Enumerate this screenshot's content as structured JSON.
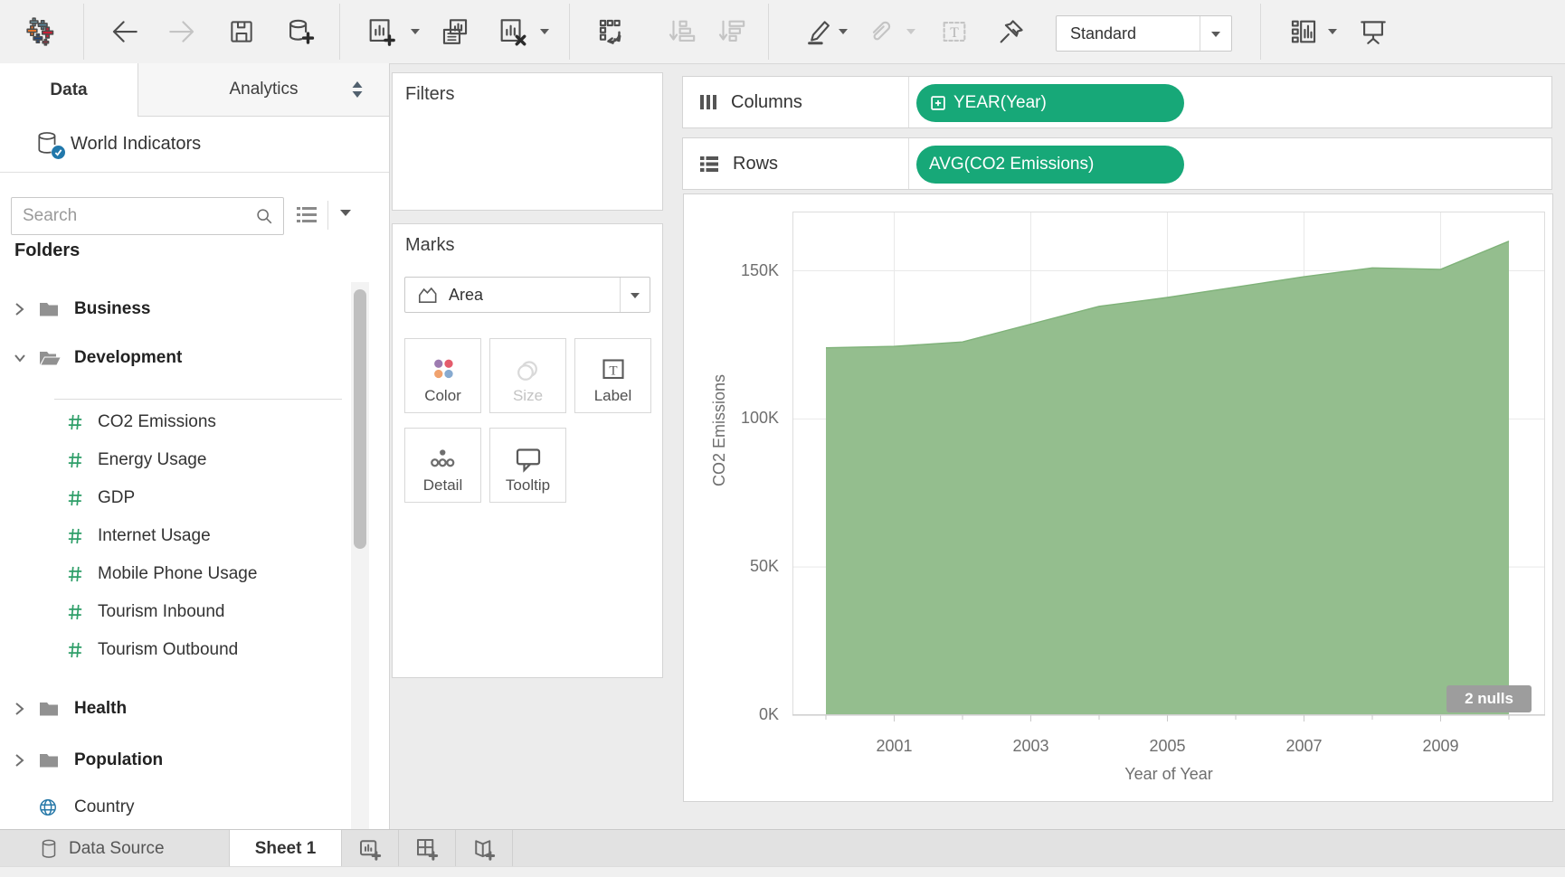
{
  "toolbar": {
    "view_mode_label": "Standard",
    "icons": [
      "tableau-logo",
      "undo",
      "redo",
      "save",
      "new-data-source",
      "new-worksheet",
      "duplicate-sheet",
      "clear-sheet",
      "swap-rows-and-columns",
      "sort-ascending",
      "sort-descending",
      "highlight",
      "paperclip",
      "text-label",
      "pin",
      "show-hide-cards",
      "presentation-mode"
    ]
  },
  "sidebar": {
    "tabs": [
      {
        "label": "Data",
        "active": true
      },
      {
        "label": "Analytics",
        "active": false
      }
    ],
    "data_source": {
      "name": "World Indicators"
    },
    "search": {
      "placeholder": "Search"
    },
    "folders_label": "Folders",
    "tree": [
      {
        "type": "folder",
        "label": "Business",
        "state": "collapsed"
      },
      {
        "type": "folder",
        "label": "Development",
        "state": "expanded"
      },
      {
        "type": "field",
        "label": "CO2 Emissions"
      },
      {
        "type": "field",
        "label": "Energy Usage"
      },
      {
        "type": "field",
        "label": "GDP"
      },
      {
        "type": "field",
        "label": "Internet Usage"
      },
      {
        "type": "field",
        "label": "Mobile Phone Usage"
      },
      {
        "type": "field",
        "label": "Tourism Inbound"
      },
      {
        "type": "field",
        "label": "Tourism Outbound"
      },
      {
        "type": "folder",
        "label": "Health",
        "state": "collapsed"
      },
      {
        "type": "folder",
        "label": "Population",
        "state": "collapsed"
      },
      {
        "type": "geo-field",
        "label": "Country"
      }
    ]
  },
  "cards": {
    "filters_title": "Filters",
    "marks": {
      "title": "Marks",
      "mark_type": "Area",
      "buttons": [
        "Color",
        "Size",
        "Label",
        "Detail",
        "Tooltip"
      ]
    }
  },
  "shelves": {
    "columns_label": "Columns",
    "rows_label": "Rows",
    "columns_pill": "YEAR(Year)",
    "rows_pill": "AVG(CO2 Emissions)"
  },
  "chart": {
    "nulls_badge": "2 nulls"
  },
  "chart_data": {
    "type": "area",
    "series_name": "AVG(CO2 Emissions)",
    "x": [
      2000,
      2001,
      2002,
      2003,
      2004,
      2005,
      2006,
      2007,
      2008,
      2009,
      2010
    ],
    "values_thousands": [
      124,
      124.5,
      126,
      132,
      138,
      141,
      144.5,
      148,
      151,
      150.5,
      160
    ],
    "xlabel": "Year of Year",
    "ylabel": "CO2 Emissions",
    "x_tick_labels": [
      2001,
      2003,
      2005,
      2007,
      2009
    ],
    "y_grid_values": [
      0,
      50,
      100,
      150
    ],
    "y_tick_labels": [
      "0K",
      "50K",
      "100K",
      "150K"
    ],
    "ylim": [
      0,
      170
    ],
    "grid": true,
    "legend": "none",
    "area_color": "#94be8e",
    "area_edge_color": "#7fb279",
    "annotation": "2 nulls"
  },
  "sheet_tabs": {
    "data_source_label": "Data Source",
    "sheets": [
      {
        "label": "Sheet 1",
        "active": true
      }
    ]
  },
  "colors": {
    "pill_green": "#17a878",
    "accent_blue": "#2178ab",
    "field_green": "#2e9e68"
  }
}
